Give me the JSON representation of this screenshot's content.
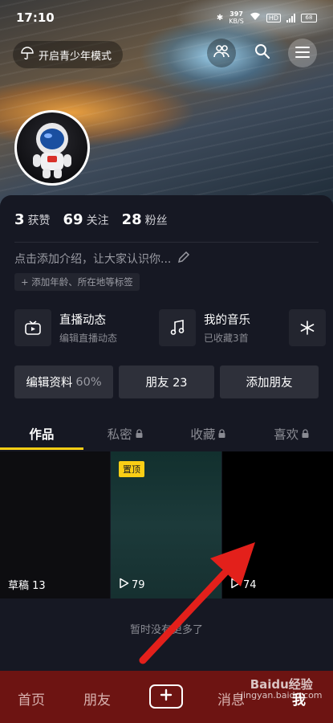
{
  "status_bar": {
    "time": "17:10",
    "net_speed": "397",
    "net_unit": "KB/S",
    "hd": "HD",
    "battery": "68"
  },
  "header": {
    "teen_mode_label": "开启青少年模式"
  },
  "stats": [
    {
      "num": "3",
      "label": "获赞"
    },
    {
      "num": "69",
      "label": "关注"
    },
    {
      "num": "28",
      "label": "粉丝"
    }
  ],
  "bio": {
    "placeholder": "点击添加介绍，让大家认识你...",
    "tag_hint": "+ 添加年龄、所在地等标签"
  },
  "features": [
    {
      "title": "直播动态",
      "sub": "编辑直播动态",
      "icon": "tv-icon"
    },
    {
      "title": "我的音乐",
      "sub": "已收藏3首",
      "icon": "music-note-icon"
    },
    {
      "icon": "sparkle-icon"
    }
  ],
  "actions": {
    "edit_profile": "编辑资料",
    "edit_progress": "60%",
    "friends": "朋友 23",
    "add_friend": "添加朋友"
  },
  "tabs": [
    {
      "label": "作品",
      "locked": false
    },
    {
      "label": "私密",
      "locked": true
    },
    {
      "label": "收藏",
      "locked": true
    },
    {
      "label": "喜欢",
      "locked": true
    }
  ],
  "grid": {
    "draft_label": "草稿 13",
    "pin_badge": "置顶",
    "video2_plays": "79",
    "video3_plays": "74"
  },
  "no_more_text": "暂时没有更多了",
  "bottom_nav": {
    "home": "首页",
    "friends": "朋友",
    "messages": "消息",
    "me": "我"
  },
  "watermark": {
    "line1": "Baidu经验",
    "line2": "jingyan.baidu.com"
  },
  "colors": {
    "accent": "#face15",
    "background": "#161823",
    "arrow": "#e3201b"
  }
}
